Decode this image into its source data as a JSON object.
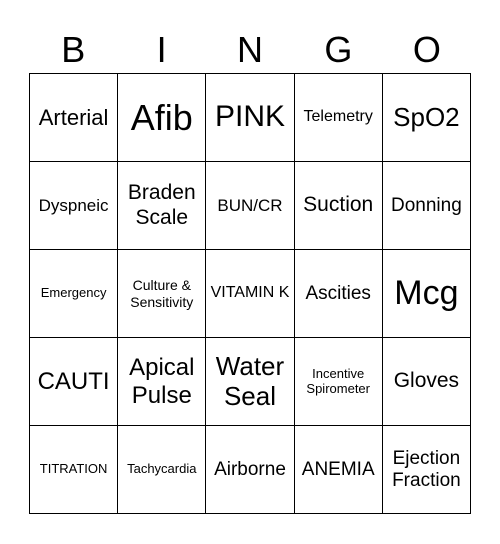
{
  "header": [
    "B",
    "I",
    "N",
    "G",
    "O"
  ],
  "cells": [
    [
      "Arterial",
      "Afib",
      "PINK",
      "Telemetry",
      "SpO2"
    ],
    [
      "Dyspneic",
      "Braden Scale",
      "BUN/CR",
      "Suction",
      "Donning"
    ],
    [
      "Emergency",
      "Culture & Sensitivity",
      "VITAMIN K",
      "Ascities",
      "Mcg"
    ],
    [
      "CAUTI",
      "Apical Pulse",
      "Water Seal",
      "Incentive Spirometer",
      "Gloves"
    ],
    [
      "TITRATION",
      "Tachycardia",
      "Airborne",
      "ANEMIA",
      "Ejection Fraction"
    ]
  ]
}
